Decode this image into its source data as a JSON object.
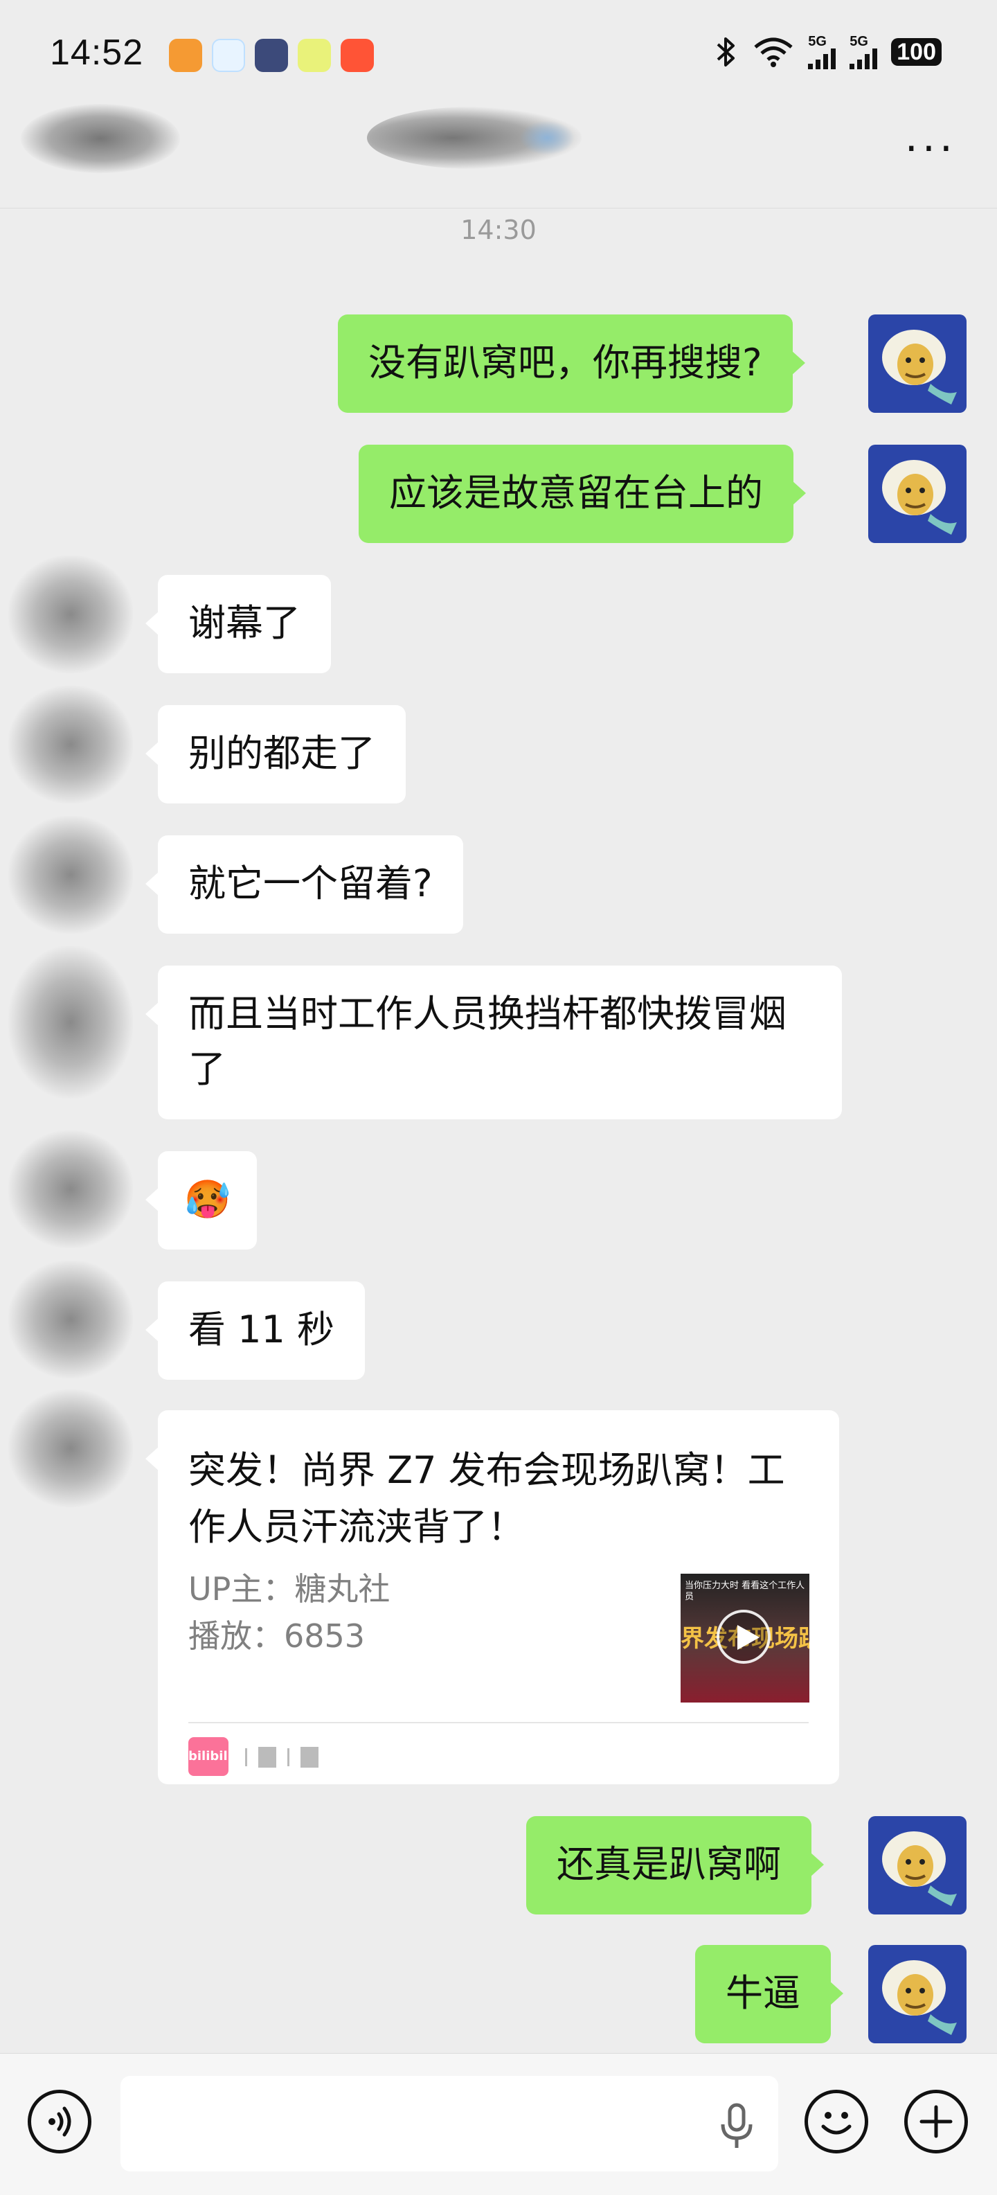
{
  "status_bar": {
    "time": "14:52",
    "signal_1_label": "5G",
    "signal_2_label": "5G",
    "battery": "100",
    "icons": [
      "bluetooth-icon",
      "wifi-icon"
    ]
  },
  "header": {
    "more_label": "···"
  },
  "chat": {
    "timestamp": "14:30",
    "messages": [
      {
        "sender": "me",
        "text": "没有趴窝吧，你再搜搜?"
      },
      {
        "sender": "me",
        "text": "应该是故意留在台上的"
      },
      {
        "sender": "other",
        "text": "谢幕了"
      },
      {
        "sender": "other",
        "text": "别的都走了"
      },
      {
        "sender": "other",
        "text": "就它一个留着?"
      },
      {
        "sender": "other",
        "text": "而且当时工作人员换挡杆都快拨冒烟了"
      },
      {
        "sender": "other",
        "text": "🥵"
      },
      {
        "sender": "other",
        "text": "看 11 秒"
      },
      {
        "sender": "me",
        "text": "还真是趴窝啊"
      },
      {
        "sender": "me",
        "text": "牛逼"
      }
    ],
    "shared_video": {
      "title": "突发！尚界 Z7 发布会现场趴窝！工作人员汗流浃背了！",
      "uploader": "UP主：糖丸社",
      "plays": "播放：6853",
      "thumbnail_text": "界发布现场趴",
      "thumbnail_caption": "当你压力大时 看看这个工作人员",
      "source_logo": "bilibili"
    }
  },
  "colors": {
    "background": "#ededed",
    "my_bubble": "#95ec69",
    "other_bubble": "#ffffff",
    "avatar_bg": "#2b45a8",
    "bili_pink": "#fb7299"
  }
}
